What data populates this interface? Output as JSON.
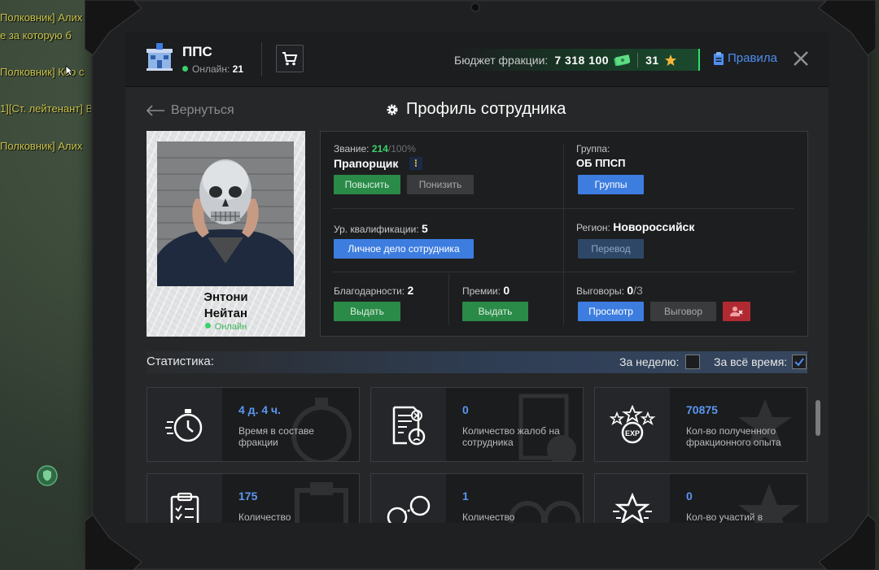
{
  "chat": [
    "Полковник] Алих",
    "е за которую б",
    "Полковник] Коо с",
    "1][Ст. лейтенант] В",
    "Полковник] Алих"
  ],
  "faction": {
    "name": "ППС",
    "online_label": "Онлайн:",
    "online_count": "21"
  },
  "budget": {
    "label": "Бюджет фракции:",
    "amount": "7 318 100",
    "stars": "31"
  },
  "rules_label": "Правила",
  "back_label": "Вернуться",
  "page_title": "Профиль сотрудника",
  "employee": {
    "first_name": "Энтони",
    "last_name": "Нейтан",
    "status": "Онлайн"
  },
  "rank": {
    "label": "Звание:",
    "progress": "214",
    "progress_max": "/100%",
    "name": "Прапорщик",
    "promote": "Повысить",
    "demote": "Понизить"
  },
  "group": {
    "label": "Группа:",
    "name": "ОБ ППСП",
    "button": "Группы"
  },
  "qualification": {
    "label": "Ур. квалификации:",
    "value": "5",
    "button": "Личное дело сотрудника"
  },
  "region": {
    "label": "Регион:",
    "name": "Новороссийск",
    "button": "Перевод"
  },
  "thanks": {
    "label": "Благодарности:",
    "value": "2",
    "button": "Выдать"
  },
  "bonuses": {
    "label": "Премии:",
    "value": "0",
    "button": "Выдать"
  },
  "reprimands": {
    "label": "Выговоры:",
    "value": "0",
    "max": "/3",
    "view": "Просмотр",
    "give": "Выговор"
  },
  "stats": {
    "title": "Статистика:",
    "week_label": "За неделю:",
    "all_label": "За всё время:",
    "week_checked": false,
    "all_checked": true,
    "cards": [
      {
        "icon": "stopwatch-icon",
        "value": "4 д. 4 ч.",
        "desc": "Время в составе фракции"
      },
      {
        "icon": "complaint-document-icon",
        "value": "0",
        "desc": "Количество жалоб на сотрудника"
      },
      {
        "icon": "exp-stars-icon",
        "value": "70875",
        "desc": "Кол-во полученного фракционного опыта"
      },
      {
        "icon": "clipboard-checklist-icon",
        "value": "175",
        "desc": "Количество"
      },
      {
        "icon": "handcuffs-icon",
        "value": "1",
        "desc": "Количество"
      },
      {
        "icon": "star-award-icon",
        "value": "0",
        "desc": "Кол-во участий в"
      }
    ]
  },
  "colors": {
    "accent_blue": "#3d7de0",
    "green": "#2a8a48",
    "red": "#b12a32",
    "online": "#3ad16a"
  }
}
